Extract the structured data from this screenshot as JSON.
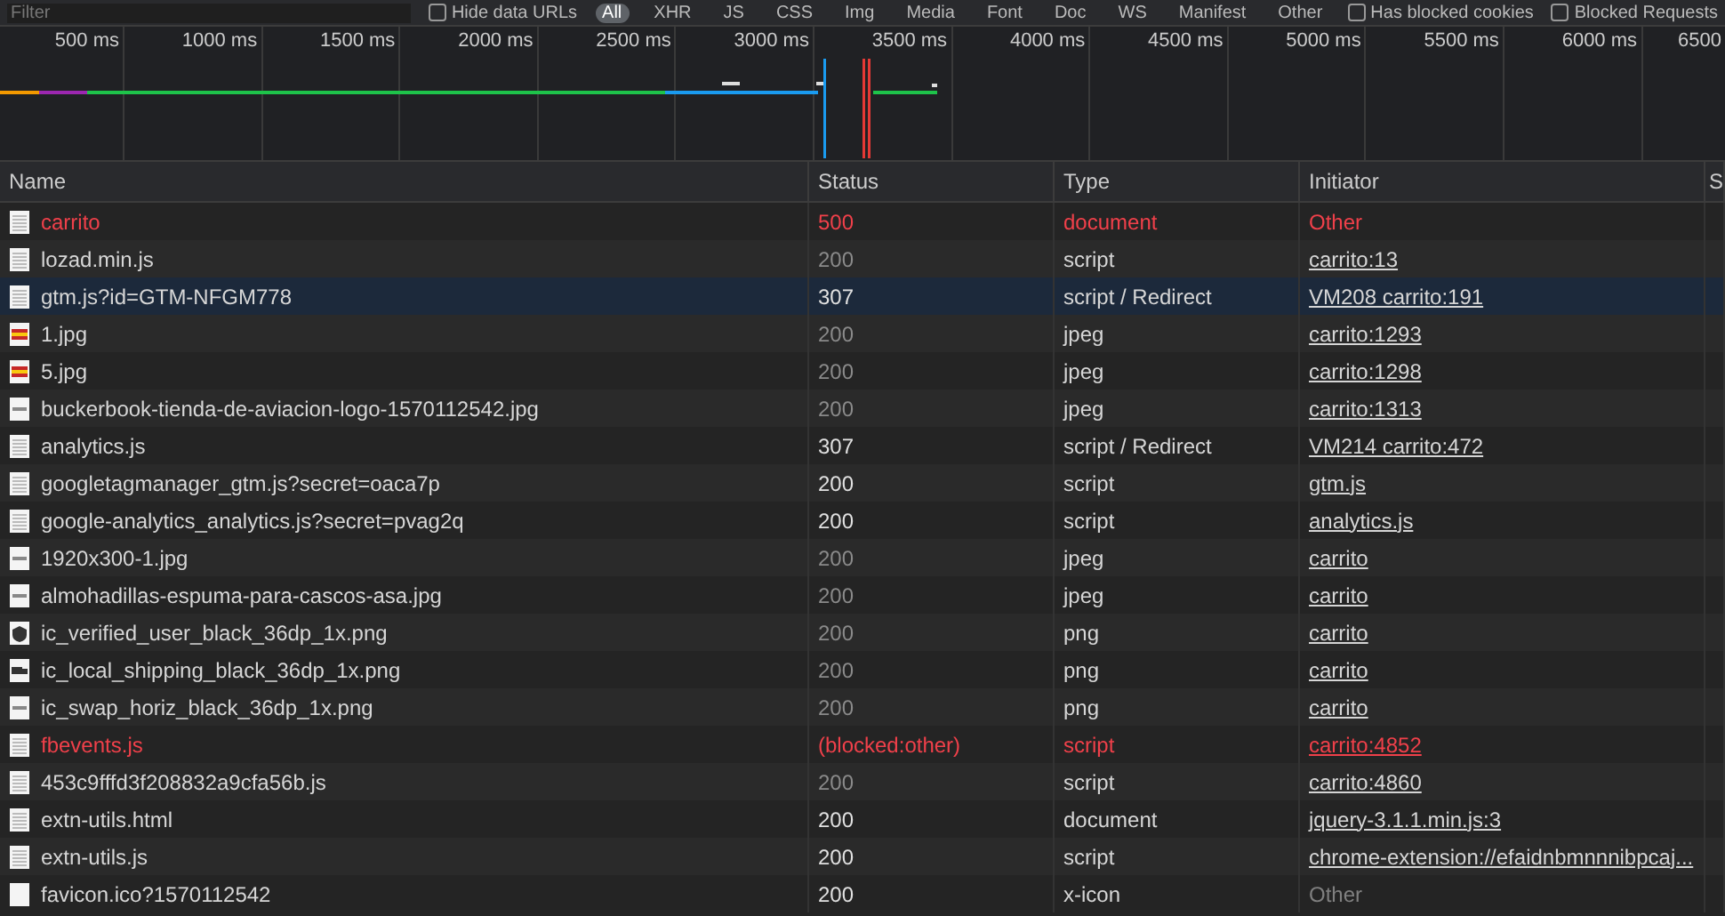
{
  "toolbar": {
    "filter_placeholder": "Filter",
    "hide_data_urls": {
      "label": "Hide data URLs",
      "checked": false
    },
    "type_filters": [
      {
        "label": "All",
        "selected": true
      },
      {
        "label": "XHR",
        "selected": false
      },
      {
        "label": "JS",
        "selected": false
      },
      {
        "label": "CSS",
        "selected": false
      },
      {
        "label": "Img",
        "selected": false
      },
      {
        "label": "Media",
        "selected": false
      },
      {
        "label": "Font",
        "selected": false
      },
      {
        "label": "Doc",
        "selected": false
      },
      {
        "label": "WS",
        "selected": false
      },
      {
        "label": "Manifest",
        "selected": false
      },
      {
        "label": "Other",
        "selected": false
      }
    ],
    "has_blocked_cookies": {
      "label": "Has blocked cookies",
      "checked": false
    },
    "blocked_requests": {
      "label": "Blocked Requests",
      "checked": false
    }
  },
  "overview": {
    "ticks": [
      "500 ms",
      "1000 ms",
      "1500 ms",
      "2000 ms",
      "2500 ms",
      "3000 ms",
      "3500 ms",
      "4000 ms",
      "4500 ms",
      "5000 ms",
      "5500 ms",
      "6000 ms",
      "6500"
    ]
  },
  "table": {
    "columns": [
      "Name",
      "Status",
      "Type",
      "Initiator",
      "S"
    ],
    "rows": [
      {
        "kind": "document",
        "name": "carrito",
        "status": "500",
        "type": "document",
        "initiator": "Other",
        "initiator_link": false,
        "error": true,
        "selected": false
      },
      {
        "kind": "script",
        "name": "lozad.min.js",
        "status": "200",
        "type": "script",
        "initiator": "carrito:13",
        "initiator_link": true,
        "error": false,
        "dim": true,
        "selected": false
      },
      {
        "kind": "script",
        "name": "gtm.js?id=GTM-NFGM778",
        "status": "307",
        "type": "script / Redirect",
        "initiator": "VM208 carrito:191",
        "initiator_link": true,
        "error": false,
        "dim": false,
        "selected": true
      },
      {
        "kind": "flag",
        "name": "1.jpg",
        "status": "200",
        "type": "jpeg",
        "initiator": "carrito:1293",
        "initiator_link": true,
        "error": false,
        "dim": true,
        "selected": false
      },
      {
        "kind": "flag",
        "name": "5.jpg",
        "status": "200",
        "type": "jpeg",
        "initiator": "carrito:1298",
        "initiator_link": true,
        "error": false,
        "dim": true,
        "selected": false
      },
      {
        "kind": "image",
        "name": "buckerbook-tienda-de-aviacion-logo-1570112542.jpg",
        "status": "200",
        "type": "jpeg",
        "initiator": "carrito:1313",
        "initiator_link": true,
        "error": false,
        "dim": true,
        "selected": false
      },
      {
        "kind": "script",
        "name": "analytics.js",
        "status": "307",
        "type": "script / Redirect",
        "initiator": "VM214 carrito:472",
        "initiator_link": true,
        "error": false,
        "dim": false,
        "selected": false
      },
      {
        "kind": "script",
        "name": "googletagmanager_gtm.js?secret=oaca7p",
        "status": "200",
        "type": "script",
        "initiator": "gtm.js",
        "initiator_link": true,
        "error": false,
        "dim": false,
        "selected": false
      },
      {
        "kind": "script",
        "name": "google-analytics_analytics.js?secret=pvag2q",
        "status": "200",
        "type": "script",
        "initiator": "analytics.js",
        "initiator_link": true,
        "error": false,
        "dim": false,
        "selected": false
      },
      {
        "kind": "image",
        "name": "1920x300-1.jpg",
        "status": "200",
        "type": "jpeg",
        "initiator": "carrito",
        "initiator_link": true,
        "error": false,
        "dim": true,
        "selected": false
      },
      {
        "kind": "image",
        "name": "almohadillas-espuma-para-cascos-asa.jpg",
        "status": "200",
        "type": "jpeg",
        "initiator": "carrito",
        "initiator_link": true,
        "error": false,
        "dim": true,
        "selected": false
      },
      {
        "kind": "shield",
        "name": "ic_verified_user_black_36dp_1x.png",
        "status": "200",
        "type": "png",
        "initiator": "carrito",
        "initiator_link": true,
        "error": false,
        "dim": true,
        "selected": false
      },
      {
        "kind": "truck",
        "name": "ic_local_shipping_black_36dp_1x.png",
        "status": "200",
        "type": "png",
        "initiator": "carrito",
        "initiator_link": true,
        "error": false,
        "dim": true,
        "selected": false
      },
      {
        "kind": "image",
        "name": "ic_swap_horiz_black_36dp_1x.png",
        "status": "200",
        "type": "png",
        "initiator": "carrito",
        "initiator_link": true,
        "error": false,
        "dim": true,
        "selected": false
      },
      {
        "kind": "script",
        "name": "fbevents.js",
        "status": "(blocked:other)",
        "type": "script",
        "initiator": "carrito:4852",
        "initiator_link": true,
        "error": true,
        "selected": false
      },
      {
        "kind": "script",
        "name": "453c9fffd3f208832a9cfa56b.js",
        "status": "200",
        "type": "script",
        "initiator": "carrito:4860",
        "initiator_link": true,
        "error": false,
        "dim": true,
        "selected": false
      },
      {
        "kind": "document",
        "name": "extn-utils.html",
        "status": "200",
        "type": "document",
        "initiator": "jquery-3.1.1.min.js:3",
        "initiator_link": true,
        "error": false,
        "dim": false,
        "selected": false
      },
      {
        "kind": "script",
        "name": "extn-utils.js",
        "status": "200",
        "type": "script",
        "initiator": "chrome-extension://efaidnbmnnnibpcaj...",
        "initiator_link": true,
        "error": false,
        "dim": false,
        "selected": false
      },
      {
        "kind": "blank",
        "name": "favicon.ico?1570112542",
        "status": "200",
        "type": "x-icon",
        "initiator": "Other",
        "initiator_link": false,
        "error": false,
        "dim": false,
        "selected": false
      }
    ]
  }
}
